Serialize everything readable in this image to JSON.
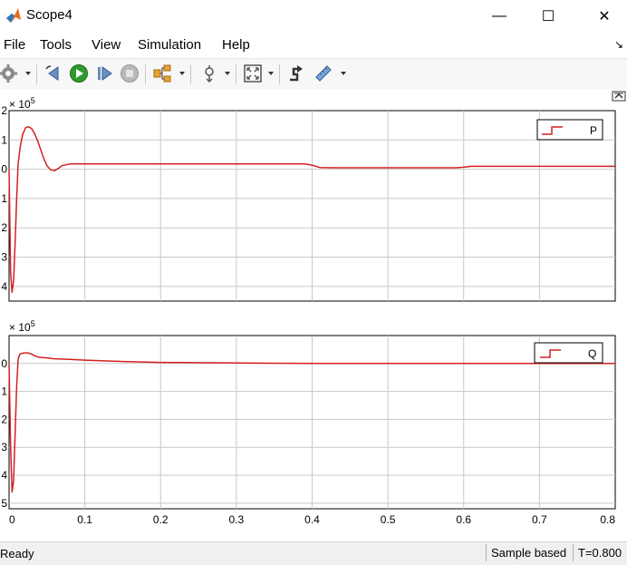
{
  "window": {
    "title": "Scope4",
    "minimize": "—",
    "maximize": "☐",
    "close": "✕"
  },
  "menu": {
    "items": [
      "File",
      "Tools",
      "View",
      "Simulation",
      "Help"
    ],
    "pin": "↘"
  },
  "toolbar": {
    "icons": [
      "gear-icon",
      "step-back-icon",
      "run-icon",
      "step-forward-icon",
      "stop-icon",
      "signal-selector-icon",
      "zoom-icon",
      "fit-to-view-icon",
      "highlight-block-icon",
      "measurements-icon"
    ]
  },
  "colors": {
    "signal": "#d42020",
    "grid": "#c8c8c8",
    "axes": "#000000"
  },
  "chart_data": [
    {
      "type": "line",
      "exponent": "× 10",
      "exponent_power": "5",
      "legend": {
        "label": "P",
        "placement": "top-right"
      },
      "xlim": [
        0,
        0.8
      ],
      "ylim": [
        -4.5,
        2
      ],
      "y_ticks": [
        2,
        1,
        0,
        -1,
        -2,
        -3,
        -4
      ],
      "y_tick_labels": [
        "2",
        "1",
        "0",
        "1",
        "2",
        "3",
        "4"
      ],
      "grid": true,
      "series": [
        {
          "name": "P",
          "x": [
            0,
            0.002,
            0.004,
            0.006,
            0.008,
            0.01,
            0.012,
            0.015,
            0.018,
            0.022,
            0.026,
            0.03,
            0.034,
            0.038,
            0.042,
            0.046,
            0.05,
            0.055,
            0.06,
            0.065,
            0.07,
            0.08,
            0.09,
            0.1,
            0.2,
            0.3,
            0.39,
            0.4,
            0.41,
            0.43,
            0.5,
            0.59,
            0.6,
            0.61,
            0.7,
            0.8
          ],
          "y": [
            0,
            -3.5,
            -4.2,
            -3.8,
            -2.5,
            -1.0,
            0.2,
            0.8,
            1.2,
            1.42,
            1.45,
            1.38,
            1.2,
            0.95,
            0.65,
            0.35,
            0.12,
            -0.02,
            -0.05,
            0.03,
            0.12,
            0.18,
            0.18,
            0.18,
            0.18,
            0.18,
            0.18,
            0.14,
            0.06,
            0.05,
            0.05,
            0.05,
            0.07,
            0.1,
            0.1,
            0.1
          ]
        }
      ]
    },
    {
      "type": "line",
      "exponent": "× 10",
      "exponent_power": "5",
      "legend": {
        "label": "Q",
        "placement": "top-right"
      },
      "xlim": [
        0,
        0.8
      ],
      "ylim": [
        -5.2,
        1
      ],
      "y_ticks": [
        0,
        -1,
        -2,
        -3,
        -4,
        -5
      ],
      "y_tick_labels": [
        "0",
        "1",
        "2",
        "3",
        "4",
        "5"
      ],
      "x_ticks": [
        0,
        0.1,
        0.2,
        0.3,
        0.4,
        0.5,
        0.6,
        0.7,
        0.8
      ],
      "x_tick_labels": [
        "0",
        "0.1",
        "0.2",
        "0.3",
        "0.4",
        "0.5",
        "0.6",
        "0.7",
        "0.8"
      ],
      "grid": true,
      "series": [
        {
          "name": "Q",
          "x": [
            0,
            0.002,
            0.004,
            0.006,
            0.008,
            0.01,
            0.012,
            0.014,
            0.016,
            0.02,
            0.025,
            0.03,
            0.035,
            0.04,
            0.05,
            0.06,
            0.08,
            0.1,
            0.15,
            0.2,
            0.3,
            0.4,
            0.5,
            0.6,
            0.7,
            0.8
          ],
          "y": [
            0,
            -3.0,
            -4.6,
            -4.2,
            -2.5,
            -0.8,
            0.15,
            0.32,
            0.35,
            0.38,
            0.38,
            0.33,
            0.26,
            0.22,
            0.2,
            0.17,
            0.15,
            0.12,
            0.07,
            0.04,
            0.02,
            0.0,
            0.0,
            0.0,
            0.0,
            0.0
          ]
        }
      ]
    }
  ],
  "status": {
    "ready": "Ready",
    "mode": "Sample based",
    "time": "T=0.800"
  }
}
